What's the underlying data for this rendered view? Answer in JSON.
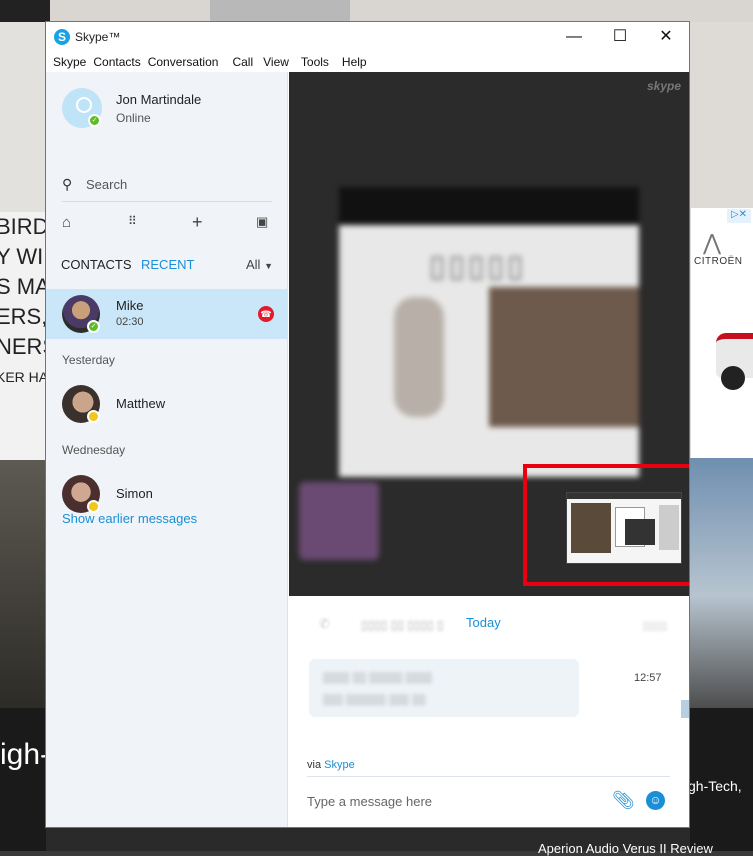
{
  "background": {
    "left_text": [
      "BIRD",
      "Y WI",
      "S MA",
      "ERS,",
      "NERS",
      "",
      "KER HA"
    ],
    "left_bottom_text": "igh-",
    "right_brand": "CITROËN",
    "right_bottom_text": "gh-Tech,",
    "bottom_text": "Aperion Audio Verus II Review"
  },
  "window": {
    "title": "Skype™",
    "app_icon": "S",
    "controls": {
      "minimize": "—",
      "maximize": "☐",
      "close": "✕"
    }
  },
  "menu": [
    "Skype",
    "Contacts",
    "Conversation",
    "Call",
    "View",
    "Tools",
    "Help"
  ],
  "profile": {
    "name": "Jon Martindale",
    "status": "Online"
  },
  "search": {
    "placeholder": "Search"
  },
  "sidebar_icons": [
    "home-icon",
    "dialpad-icon",
    "add-icon",
    "bot-icon"
  ],
  "tabs": {
    "contacts": "CONTACTS",
    "recent": "RECENT",
    "filter": "All"
  },
  "contacts": {
    "mike": {
      "name": "Mike",
      "duration": "02:30"
    },
    "yesterday_label": "Yesterday",
    "matthew": {
      "name": "Matthew"
    },
    "wednesday_label": "Wednesday",
    "simon": {
      "name": "Simon"
    },
    "show_earlier": "Show earlier messages"
  },
  "conversation": {
    "watermark": "skype",
    "today_label": "Today",
    "message_time": "12:57",
    "via_prefix": "via",
    "via_link": "Skype",
    "composer_placeholder": "Type a message here"
  },
  "colors": {
    "accent": "#1a8fd6",
    "active_row": "#c9e7f8",
    "sidebar_bg": "#f0f4f9",
    "online": "#5dbb28",
    "hangup": "#e21a2c",
    "highlight_box": "#e60012"
  }
}
